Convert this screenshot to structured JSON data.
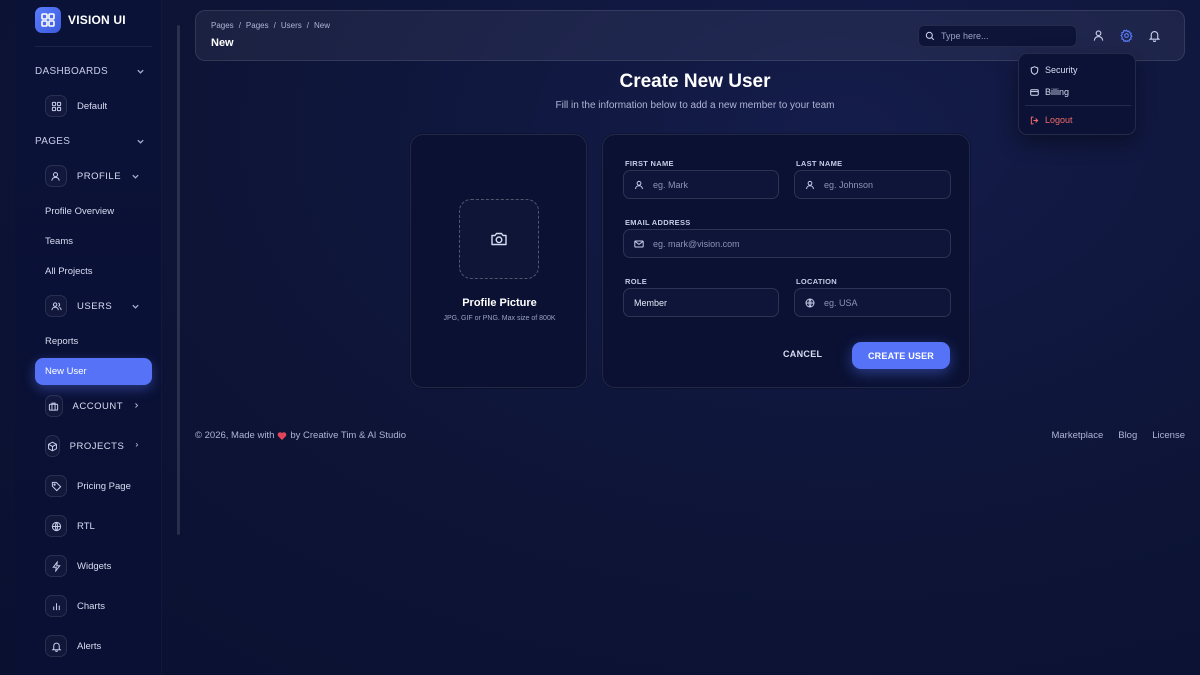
{
  "brand": {
    "name": "VISION UI"
  },
  "sidebar": {
    "dashboards_label": "DASHBOARDS",
    "default_label": "Default",
    "pages_label": "PAGES",
    "profile_label": "PROFILE",
    "profile_items": [
      "Profile Overview",
      "Teams",
      "All Projects"
    ],
    "users_label": "USERS",
    "users_items": [
      "Reports",
      "New User"
    ],
    "account_label": "ACCOUNT",
    "projects_label": "PROJECTS",
    "pricing_label": "Pricing Page",
    "rtl_label": "RTL",
    "widgets_label": "Widgets",
    "charts_label": "Charts",
    "alerts_label": "Alerts"
  },
  "topbar": {
    "breadcrumb": [
      "Pages",
      "/",
      "Pages",
      "/",
      "Users",
      "/",
      "New"
    ],
    "title": "New",
    "search_placeholder": "Type here..."
  },
  "dropdown": {
    "security": "Security",
    "billing": "Billing",
    "logout": "Logout"
  },
  "main": {
    "title": "Create New User",
    "subtitle": "Fill in the information below to add a new member to your team"
  },
  "profile_card": {
    "title": "Profile Picture",
    "hint": "JPG, GIF or PNG. Max size of 800K"
  },
  "form": {
    "first_name_label": "FIRST NAME",
    "first_name_placeholder": "eg. Mark",
    "last_name_label": "LAST NAME",
    "last_name_placeholder": "eg. Johnson",
    "email_label": "EMAIL ADDRESS",
    "email_placeholder": "eg. mark@vision.com",
    "role_label": "ROLE",
    "role_value": "Member",
    "location_label": "LOCATION",
    "location_placeholder": "eg. USA",
    "cancel_label": "CANCEL",
    "create_label": "CREATE USER"
  },
  "footer": {
    "prefix": "© 2026, Made with",
    "suffix": "by Creative Tim & AI Studio",
    "links": [
      "Marketplace",
      "Blog",
      "License"
    ]
  },
  "colors": {
    "accent": "#5673f7",
    "background": "#0d1436",
    "logout": "#f06a6a",
    "heart": "#e0455a"
  }
}
